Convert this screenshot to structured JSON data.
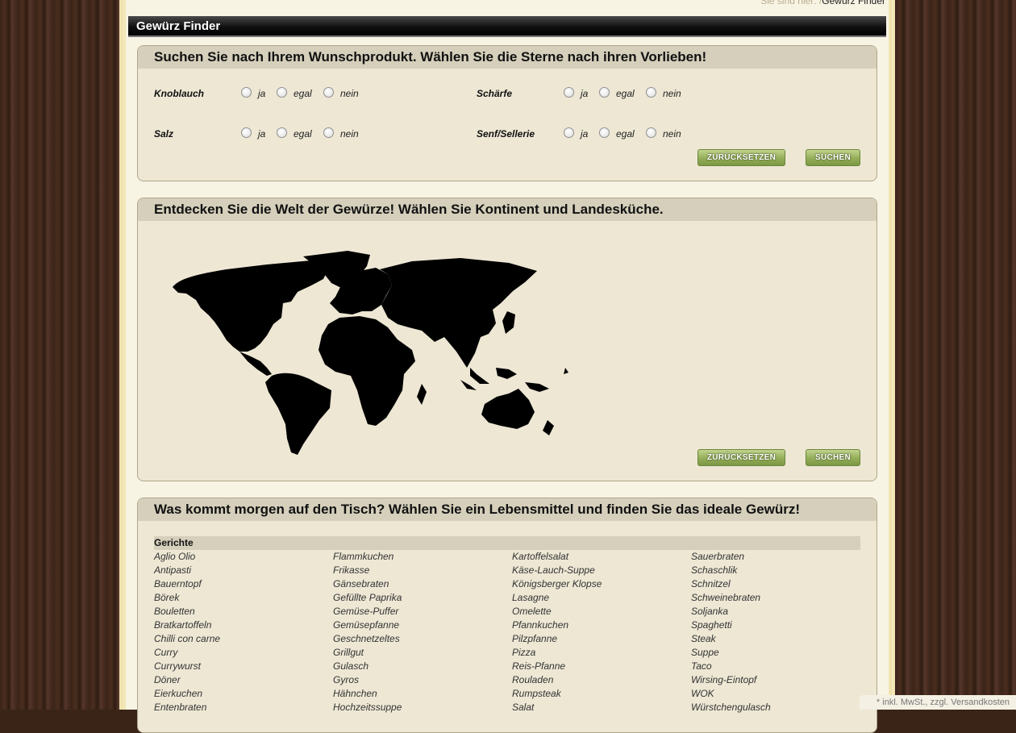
{
  "breadcrumb": {
    "prefix": "Sie sind hier: /",
    "current": "Gewürz Finder"
  },
  "page_title": "Gewürz Finder",
  "search_panel": {
    "heading": "Suchen Sie nach Ihrem Wunschprodukt. Wählen Sie die Sterne nach ihren Vorlieben!",
    "preferences": [
      {
        "label": "Knoblauch",
        "options": [
          "ja",
          "egal",
          "nein"
        ]
      },
      {
        "label": "Schärfe",
        "options": [
          "ja",
          "egal",
          "nein"
        ]
      },
      {
        "label": "Salz",
        "options": [
          "ja",
          "egal",
          "nein"
        ]
      },
      {
        "label": "Senf/Sellerie",
        "options": [
          "ja",
          "egal",
          "nein"
        ]
      }
    ],
    "reset_label": "ZURÜCKSETZEN",
    "search_label": "SUCHEN"
  },
  "world_panel": {
    "heading": "Entdecken Sie die Welt der Gewürze! Wählen Sie Kontinent und Landesküche.",
    "map_icon": "world-map",
    "reset_label": "ZURÜCKSETZEN",
    "search_label": "SUCHEN"
  },
  "food_panel": {
    "heading": "Was kommt morgen auf den Tisch? Wählen Sie ein Lebensmittel und finden Sie das ideale Gewürz!",
    "table_header": "Gerichte",
    "columns": [
      [
        "Aglio Olio",
        "Antipasti",
        "Bauerntopf",
        "Börek",
        "Bouletten",
        "Bratkartoffeln",
        "Chilli con carne",
        "Curry",
        "Currywurst",
        "Döner",
        "Eierkuchen",
        "Entenbraten"
      ],
      [
        "Flammkuchen",
        "Frikasse",
        "Gänsebraten",
        "Gefüllte Paprika",
        "Gemüse-Puffer",
        "Gemüsepfanne",
        "Geschnetzeltes",
        "Grillgut",
        "Gulasch",
        "Gyros",
        "Hähnchen",
        "Hochzeitssuppe"
      ],
      [
        "Kartoffelsalat",
        "Käse-Lauch-Suppe",
        "Königsberger Klopse",
        "Lasagne",
        "Omelette",
        "Pfannkuchen",
        "Pilzpfanne",
        "Pizza",
        "Reis-Pfanne",
        "Rouladen",
        "Rumpsteak",
        "Salat"
      ],
      [
        "Sauerbraten",
        "Schaschlik",
        "Schnitzel",
        "Schweinebraten",
        "Soljanka",
        "Spaghetti",
        "Steak",
        "Suppe",
        "Taco",
        "Wirsing-Eintopf",
        "WOK",
        "Würstchengulasch"
      ]
    ]
  },
  "footer_note": "* inkl. MwSt., zzgl. Versandkosten",
  "colors": {
    "button_green": "#93ad58",
    "panel_bg": "#ede7d4",
    "header_bar": "#000000",
    "wood": "#3b2418"
  }
}
